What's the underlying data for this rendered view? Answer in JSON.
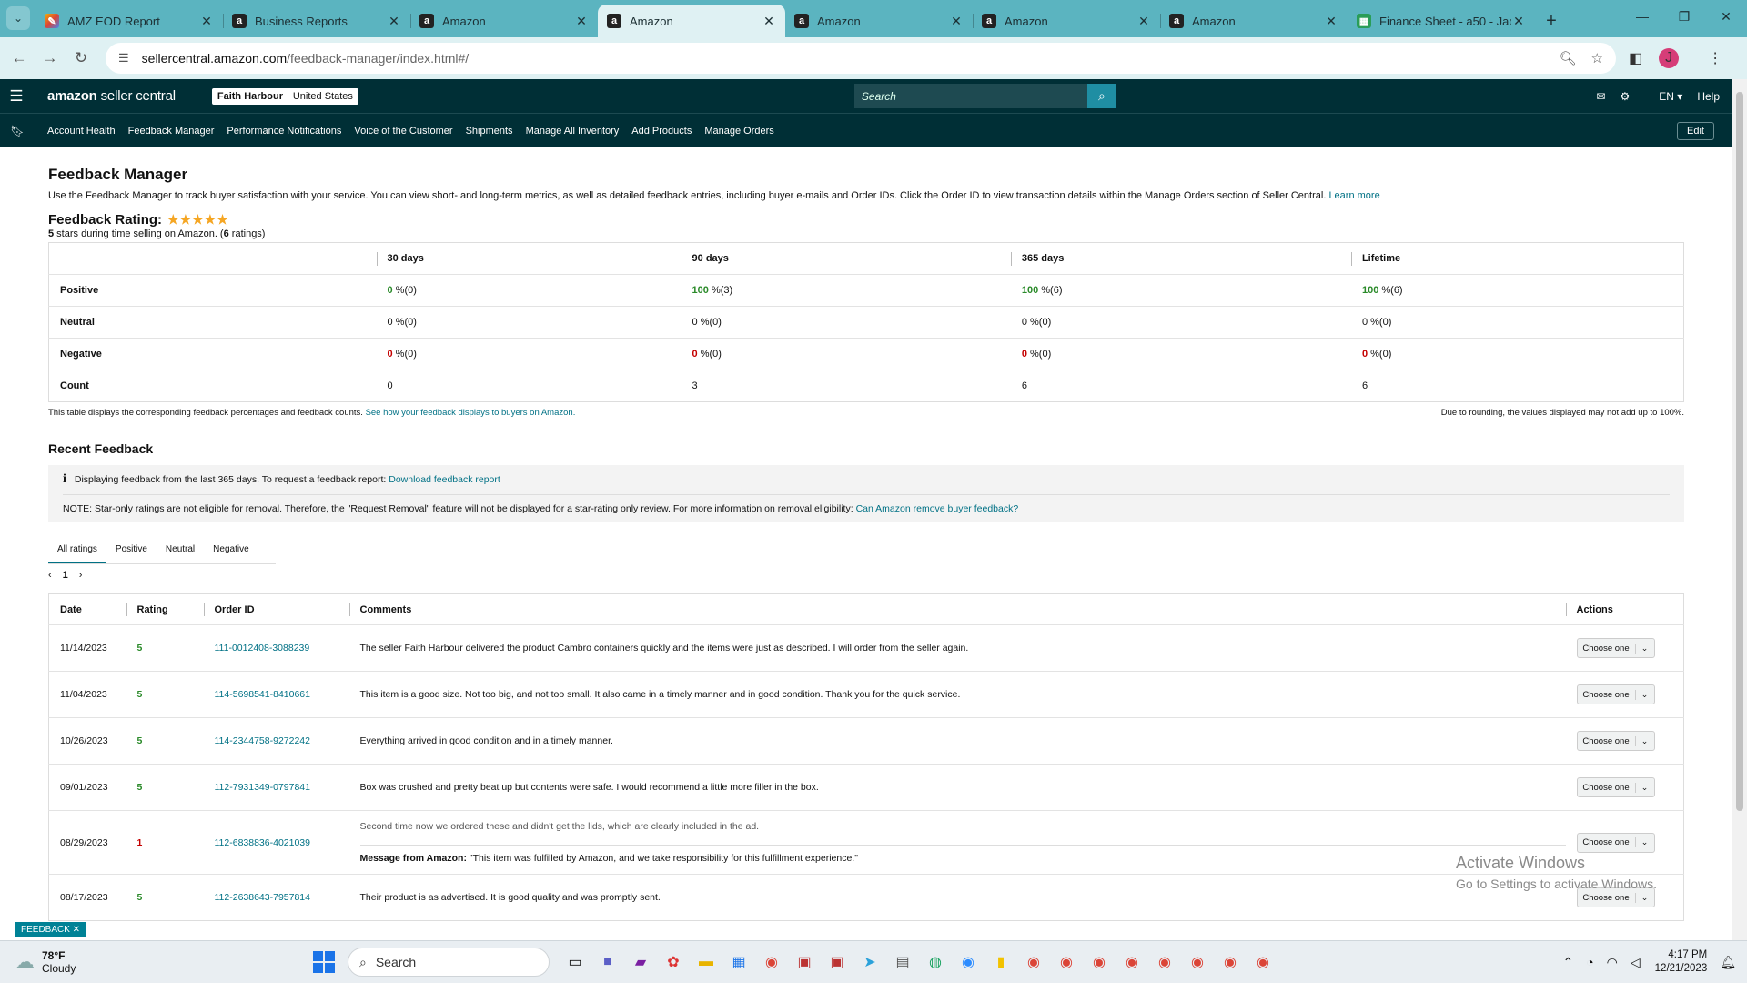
{
  "browser": {
    "tabs": [
      {
        "title": "AMZ EOD Report",
        "icon": "google-icon"
      },
      {
        "title": "Business Reports",
        "icon": "amazon-icon"
      },
      {
        "title": "Amazon",
        "icon": "amazon-icon"
      },
      {
        "title": "Amazon",
        "icon": "amazon-icon",
        "active": true
      },
      {
        "title": "Amazon",
        "icon": "amazon-icon"
      },
      {
        "title": "Amazon",
        "icon": "amazon-icon"
      },
      {
        "title": "Amazon",
        "icon": "amazon-icon"
      },
      {
        "title": "Finance Sheet - a50 - Jac",
        "icon": "sheets-icon"
      }
    ],
    "url_host": "sellercentral.amazon.com",
    "url_path": "/feedback-manager/index.html#/",
    "profile_initial": "J"
  },
  "seller_central": {
    "logo_main": "amazon",
    "logo_sub": " seller central",
    "account_name": "Faith Harbour",
    "account_marketplace": "United States",
    "search_placeholder": "Search",
    "language": "EN",
    "help": "Help",
    "nav": [
      "Account Health",
      "Feedback Manager",
      "Performance Notifications",
      "Voice of the Customer",
      "Shipments",
      "Manage All Inventory",
      "Add Products",
      "Manage Orders"
    ],
    "edit": "Edit"
  },
  "page": {
    "title": "Feedback Manager",
    "description": "Use the Feedback Manager to track buyer satisfaction with your service. You can view short- and long-term metrics, as well as detailed feedback entries, including buyer e-mails and Order IDs. Click the Order ID to view transaction details within the Manage Orders section of Seller Central.",
    "learn_more": "Learn more",
    "rating_label": "Feedback Rating:",
    "stars": "★★★★★",
    "rating_summary_pre": "5",
    "rating_summary_mid": " stars during time selling on Amazon. (",
    "rating_summary_count": "6",
    "rating_summary_post": " ratings)",
    "table_note": "This table displays the corresponding feedback percentages and feedback counts.",
    "table_note_link": "See how your feedback displays to buyers on Amazon.",
    "rounding_note": "Due to rounding, the values displayed may not add up to 100%.",
    "recent_title": "Recent Feedback",
    "info_line": "Displaying feedback from the last 365 days. To request a feedback report:",
    "info_link": "Download feedback report",
    "note_line": "NOTE: Star-only ratings are not eligible for removal. Therefore, the \"Request Removal\" feature will not be displayed for a star-rating only review. For more information on removal eligibility:",
    "note_link": "Can Amazon remove buyer feedback?",
    "filter_tabs": [
      "All ratings",
      "Positive",
      "Neutral",
      "Negative"
    ],
    "page_number": "1"
  },
  "rating_table": {
    "headers": [
      "30 days",
      "90 days",
      "365 days",
      "Lifetime"
    ],
    "rows": [
      {
        "label": "Positive",
        "cells": [
          [
            "0",
            " %(0)"
          ],
          [
            "100",
            " %(3)"
          ],
          [
            "100",
            " %(6)"
          ],
          [
            "100",
            " %(6)"
          ]
        ]
      },
      {
        "label": "Neutral",
        "cells": [
          [
            "0",
            " %(0)"
          ],
          [
            "0",
            " %(0)"
          ],
          [
            "0",
            " %(0)"
          ],
          [
            "0",
            " %(0)"
          ]
        ]
      },
      {
        "label": "Negative",
        "cells": [
          [
            "0",
            " %(0)"
          ],
          [
            "0",
            " %(0)"
          ],
          [
            "0",
            " %(0)"
          ],
          [
            "0",
            " %(0)"
          ]
        ]
      },
      {
        "label": "Count",
        "cells": [
          [
            "",
            "0"
          ],
          [
            "",
            "3"
          ],
          [
            "",
            "6"
          ],
          [
            "",
            "6"
          ]
        ]
      }
    ]
  },
  "feedback_table": {
    "headers": [
      "Date",
      "Rating",
      "Order ID",
      "Comments",
      "Actions"
    ],
    "action_label": "Choose one",
    "rows": [
      {
        "date": "11/14/2023",
        "rating": "5",
        "order_id": "111-0012408-3088239",
        "comment": "The seller Faith Harbour delivered the product Cambro containers quickly and the items were just as described. I will order from the seller again."
      },
      {
        "date": "11/04/2023",
        "rating": "5",
        "order_id": "114-5698541-8410661",
        "comment": "This item is a good size. Not too big, and not too small. It also came in a timely manner and in good condition. Thank you for the quick service."
      },
      {
        "date": "10/26/2023",
        "rating": "5",
        "order_id": "114-2344758-9272242",
        "comment": "Everything arrived in good condition and in a timely manner."
      },
      {
        "date": "09/01/2023",
        "rating": "5",
        "order_id": "112-7931349-0797841",
        "comment": "Box was crushed and pretty beat up but contents were safe. I would recommend a little more filler in the box."
      },
      {
        "date": "08/29/2023",
        "rating": "1",
        "order_id": "112-6838836-4021039",
        "comment": "Second time now we ordered these and didn't get the lids, which are clearly included in the ad.",
        "struck": true,
        "amazon_label": "Message from Amazon:",
        "amazon_message": " \"This item was fulfilled by Amazon, and we take responsibility for this fulfillment experience.\""
      },
      {
        "date": "08/17/2023",
        "rating": "5",
        "order_id": "112-2638643-7957814",
        "comment": "Their product is as advertised. It is good quality and was promptly sent."
      }
    ]
  },
  "overlay": {
    "watermark_title": "Activate Windows",
    "watermark_sub": "Go to Settings to activate Windows.",
    "feedback_badge": "FEEDBACK ✕"
  },
  "taskbar": {
    "temperature": "78°F",
    "condition": "Cloudy",
    "search": "Search",
    "time": "4:17 PM",
    "date": "12/21/2023"
  },
  "colors": {
    "header_bg": "#002f36",
    "link": "#007185",
    "positive": "#2a8a29",
    "negative": "#c40000",
    "tabstrip": "#5bb4c0"
  }
}
